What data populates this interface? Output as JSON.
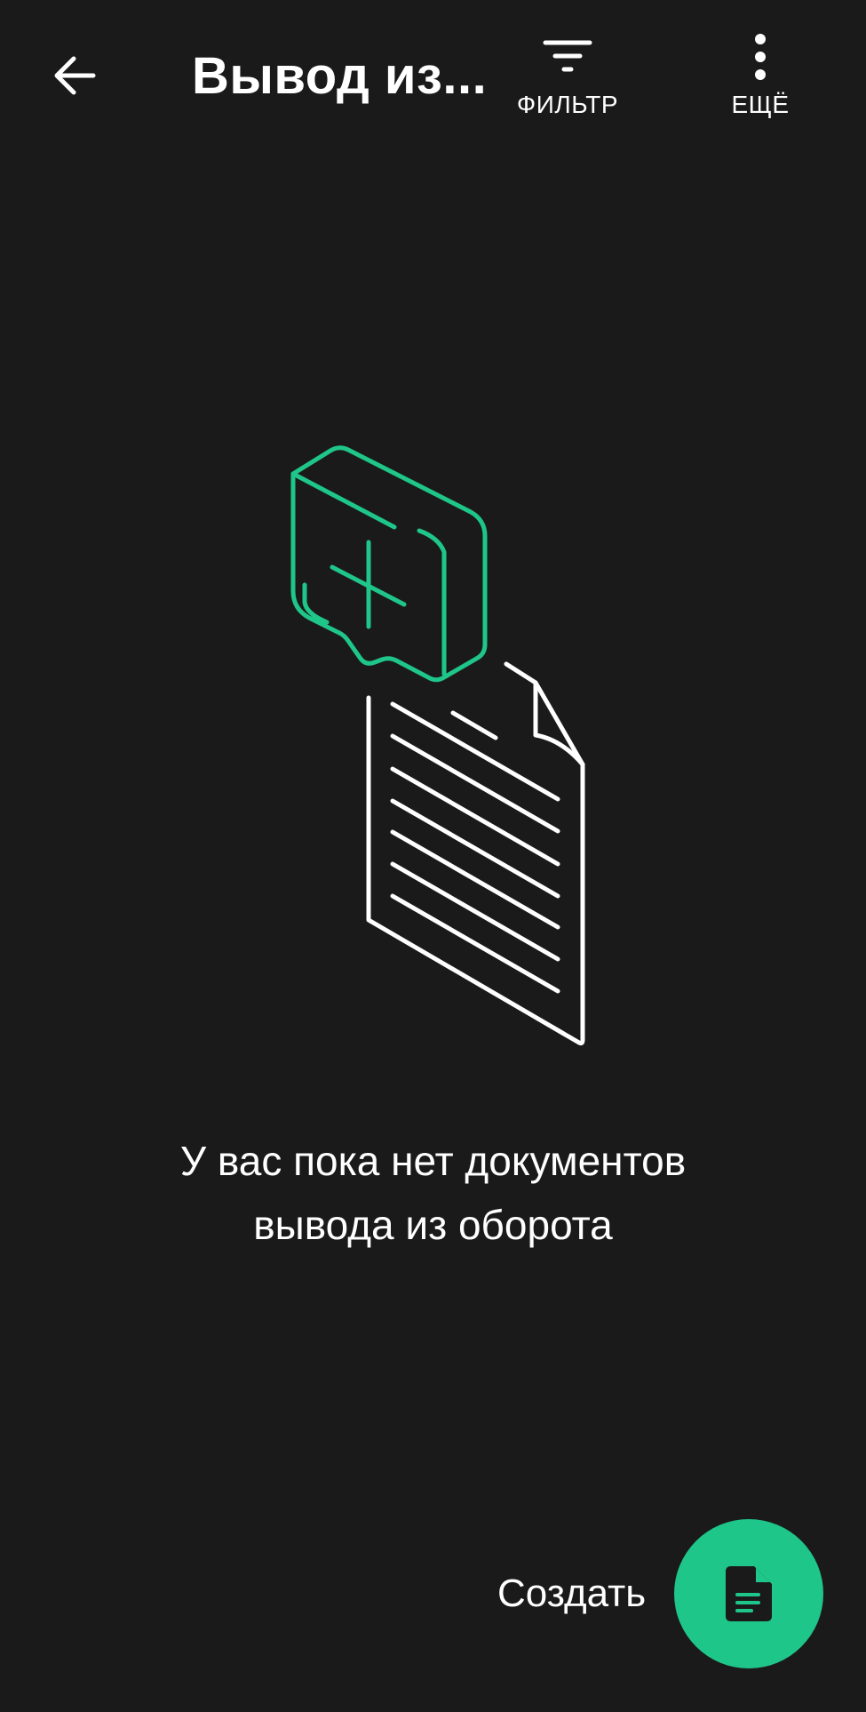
{
  "header": {
    "title": "Вывод из...",
    "back_icon": "arrow-left-icon",
    "filter": {
      "label": "ФИЛЬТР",
      "icon": "filter-icon"
    },
    "more": {
      "label": "ЕЩЁ",
      "icon": "more-vertical-icon"
    }
  },
  "empty_state": {
    "illustration": "document-with-speech-bubble-illustration",
    "line1": "У вас пока нет документов",
    "line2": "вывода из оборота"
  },
  "fab": {
    "label": "Создать",
    "icon": "document-icon"
  },
  "colors": {
    "background": "#1b1a1b",
    "accent": "#1fc68a",
    "text": "#ffffff"
  }
}
